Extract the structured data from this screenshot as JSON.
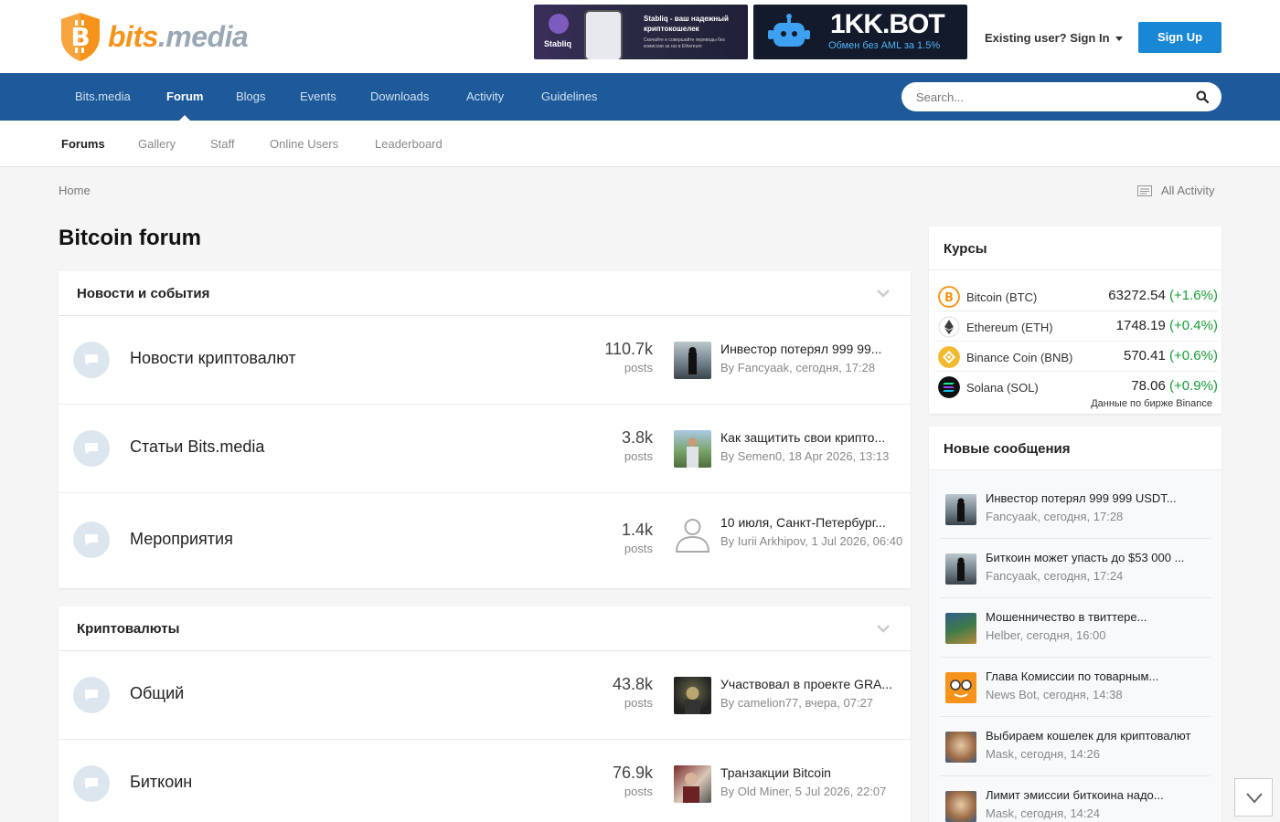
{
  "header": {
    "logo": "bits.media",
    "logo_part1": "bits",
    "logo_part2": ".media",
    "banner1": {
      "brand": "Stabliq",
      "title": "Stabliq - ваш надежный криптокошелек",
      "subtitle": "Скачайте и совершайте переводы без комиссии за газ в Ethereum"
    },
    "banner2": {
      "title": "1KK.BOT",
      "subtitle": "Обмен без AML за 1.5%"
    },
    "signin_label": "Existing user? Sign In",
    "signup_label": "Sign Up"
  },
  "nav": {
    "items": [
      {
        "label": "Bits.media",
        "active": false
      },
      {
        "label": "Forum",
        "active": true
      },
      {
        "label": "Blogs",
        "active": false
      },
      {
        "label": "Events",
        "active": false
      },
      {
        "label": "Downloads",
        "active": false
      },
      {
        "label": "Activity",
        "active": false
      },
      {
        "label": "Guidelines",
        "active": false
      }
    ],
    "search_placeholder": "Search..."
  },
  "subnav": {
    "items": [
      {
        "label": "Forums",
        "active": true
      },
      {
        "label": "Gallery",
        "active": false
      },
      {
        "label": "Staff",
        "active": false
      },
      {
        "label": "Online Users",
        "active": false
      },
      {
        "label": "Leaderboard",
        "active": false
      }
    ]
  },
  "breadcrumb": "Home",
  "all_activity": "All Activity",
  "page_title": "Bitcoin forum",
  "sections": [
    {
      "title": "Новости и события",
      "forums": [
        {
          "name": "Новости криптовалют",
          "count": "110.7k",
          "count_label": "posts",
          "last_title": "Инвестор потерял 999 99...",
          "last_meta": "By Fancyaak, сегодня, 17:28"
        },
        {
          "name": "Статьи Bits.media",
          "count": "3.8k",
          "count_label": "posts",
          "last_title": "Как защитить свои крипто...",
          "last_meta": "By Semen0, 18 Apr 2026, 13:13"
        },
        {
          "name": "Мероприятия",
          "count": "1.4k",
          "count_label": "posts",
          "last_title": "10 июля, Санкт-Петербург...",
          "last_meta": "By Iurii Arkhipov, 1 Jul 2026, 06:40"
        }
      ]
    },
    {
      "title": "Криптовалюты",
      "forums": [
        {
          "name": "Общий",
          "count": "43.8k",
          "count_label": "posts",
          "last_title": "Участвовал в проекте GRA...",
          "last_meta": "By camelion77, вчера, 07:27"
        },
        {
          "name": "Биткоин",
          "count": "76.9k",
          "count_label": "posts",
          "last_title": "Транзакции Bitcoin",
          "last_meta": "By Old Miner, 5 Jul 2026, 22:07"
        }
      ]
    }
  ],
  "rates": {
    "title": "Курсы",
    "coins": [
      {
        "name": "Bitcoin (BTC)",
        "price": "63272.54",
        "change": "(+1.6%)",
        "color": "#f7931a"
      },
      {
        "name": "Ethereum (ETH)",
        "price": "1748.19",
        "change": "(+0.4%)",
        "color": "#3c3c3d"
      },
      {
        "name": "Binance Coin (BNB)",
        "price": "570.41",
        "change": "(+0.6%)",
        "color": "#f3ba2f"
      },
      {
        "name": "Solana (SOL)",
        "price": "78.06",
        "change": "(+0.9%)",
        "color": "#111111"
      }
    ],
    "note": "Данные по бирже Binance"
  },
  "new_messages": {
    "title": "Новые сообщения",
    "items": [
      {
        "title": "Инвестор потерял 999 999 USDT...",
        "meta": "Fancyaak, сегодня, 17:28"
      },
      {
        "title": "Биткоин может упасть до $53 000 ...",
        "meta": "Fancyaak, сегодня, 17:24"
      },
      {
        "title": "Мошенничество в твиттере...",
        "meta": "Helber, сегодня, 16:00"
      },
      {
        "title": "Глава Комиссии по товарным...",
        "meta": "News Bot, сегодня, 14:38"
      },
      {
        "title": "Выбираем кошелек для криптовалют",
        "meta": "Mask, сегодня, 14:26"
      },
      {
        "title": "Лимит эмиссии биткоина надо...",
        "meta": "Mask, сегодня, 14:24"
      }
    ]
  },
  "colors": {
    "accent": "#1e5a9a",
    "button": "#1a87d5",
    "positive": "#1a9e3a",
    "brand_orange": "#f7931a"
  }
}
